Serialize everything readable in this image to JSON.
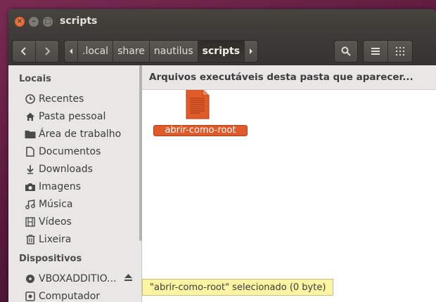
{
  "window": {
    "title": "scripts",
    "buttons": {
      "close": "×",
      "minimize": "–",
      "maximize": "□"
    }
  },
  "toolbar": {
    "back_icon": "chevron-left-icon",
    "forward_icon": "chevron-right-icon",
    "path": [
      ".local",
      "share",
      "nautilus",
      "scripts"
    ],
    "active_crumb": "scripts",
    "search_icon": "search-icon",
    "list_view_icon": "list-icon",
    "grid_view_icon": "grid-icon"
  },
  "sidebar": {
    "locais_heading": "Locais",
    "locais": [
      {
        "label": "Recentes",
        "icon": "clock-icon"
      },
      {
        "label": "Pasta pessoal",
        "icon": "home-icon"
      },
      {
        "label": "Área de trabalho",
        "icon": "folder-icon"
      },
      {
        "label": "Documentos",
        "icon": "document-icon"
      },
      {
        "label": "Downloads",
        "icon": "download-icon"
      },
      {
        "label": "Imagens",
        "icon": "camera-icon"
      },
      {
        "label": "Música",
        "icon": "music-icon"
      },
      {
        "label": "Vídeos",
        "icon": "film-icon"
      },
      {
        "label": "Lixeira",
        "icon": "trash-icon"
      }
    ],
    "dispositivos_heading": "Dispositivos",
    "dispositivos": [
      {
        "label": "VBOXADDITIO...",
        "icon": "disc-icon",
        "eject": true
      },
      {
        "label": "Computador",
        "icon": "drive-icon"
      }
    ]
  },
  "main": {
    "header": "Arquivos executáveis desta pasta que aparecer...",
    "files": [
      {
        "name": "abrir-como-root",
        "icon": "text-file-icon",
        "selected": true,
        "color": "#e05a2a"
      }
    ]
  },
  "status": {
    "text": "\"abrir-como-root\" selecionado  (0 byte)"
  },
  "colors": {
    "accent": "#e05a2a",
    "titlebar": "#3c3b37",
    "sidebar": "#e8e7e5",
    "statusbar": "#faf4a3"
  }
}
